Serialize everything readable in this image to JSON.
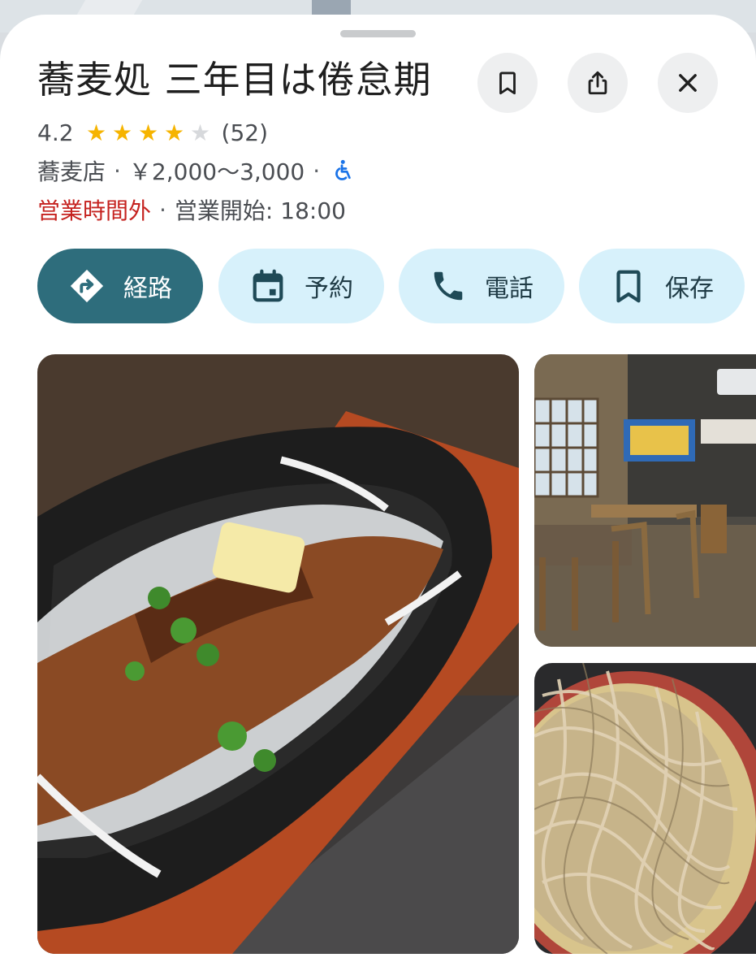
{
  "place": {
    "name": "蕎麦処 三年目は倦怠期",
    "rating": "4.2",
    "rating_value": 4.2,
    "rating_max": 5,
    "review_count": "(52)",
    "category": "蕎麦店",
    "price_range": "￥2,000～3,000",
    "separator": "·",
    "status": "営業時間外",
    "opening": "営業開始: 18:00",
    "wheelchair_icon": "wheelchair-accessible-icon"
  },
  "header_actions": {
    "save_icon": "bookmark-icon",
    "share_icon": "share-icon",
    "close_icon": "close-icon"
  },
  "actions": [
    {
      "label": "経路",
      "icon": "directions-icon"
    },
    {
      "label": "予約",
      "icon": "calendar-icon"
    },
    {
      "label": "電話",
      "icon": "phone-icon"
    },
    {
      "label": "保存",
      "icon": "bookmark-icon"
    }
  ],
  "photos": [
    {
      "subject": "sizzling-plate-dish"
    },
    {
      "subject": "restaurant-interior"
    },
    {
      "subject": "zaru-soba"
    }
  ],
  "colors": {
    "primary_button": "#2e6d7c",
    "secondary_button": "#d7f1fb",
    "star": "#f6b400",
    "closed": "#c5221f",
    "accessibility": "#1a73e8"
  }
}
